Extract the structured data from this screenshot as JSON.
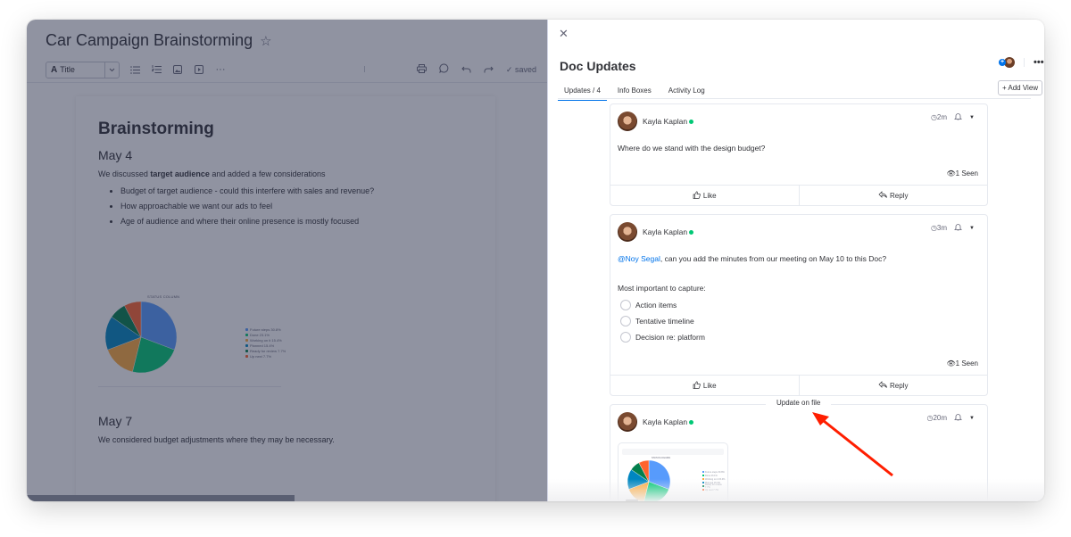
{
  "doc": {
    "title": "Car Campaign Brainstorming",
    "toolbar": {
      "style_select_icon": "A",
      "style_select_value": "Title",
      "icons": [
        "bulleted-list-icon",
        "numbered-list-icon",
        "image-icon",
        "video-icon",
        "more-icon"
      ],
      "right_icons": [
        "print-icon",
        "comment-icon",
        "undo-icon",
        "redo-icon"
      ],
      "saved_label": "saved"
    },
    "heading": "Brainstorming",
    "sections": [
      {
        "date": "May 4",
        "intro_prefix": "We discussed ",
        "intro_bold": "target audience",
        "intro_suffix": " and added a few considerations",
        "bullets": [
          "Budget of target audience - could this interfere with sales and revenue?",
          "How approachable we want our ads to feel",
          "Age of audience and where their online presence is mostly focused"
        ]
      },
      {
        "date": "May 7",
        "text": "We considered budget adjustments where they may be necessary."
      }
    ]
  },
  "chart_data": {
    "type": "pie",
    "title": "STATUS COLUMN",
    "categories": [
      "Future steps",
      "Done",
      "Working on it",
      "Planned",
      "Ready for review",
      "Up next"
    ],
    "values": [
      30.8,
      23.1,
      15.4,
      15.4,
      7.7,
      7.7
    ],
    "legend_labels": [
      "Future steps 30.8%",
      "Done 23.1%",
      "Working on it 15.4%",
      "Planned 15.4%",
      "Ready for review 7.7%",
      "Up next 7.7%"
    ],
    "colors": [
      "#579bfc",
      "#00c875",
      "#fdab3d",
      "#0086c0",
      "#037f4c",
      "#ff642e"
    ],
    "legend_position": "right"
  },
  "panel": {
    "close_icon": "close-icon",
    "title": "Doc Updates",
    "tabs": [
      {
        "label": "Updates / 4",
        "active": true
      },
      {
        "label": "Info Boxes",
        "active": false
      },
      {
        "label": "Activity Log",
        "active": false
      }
    ],
    "subscribe_plus": "+",
    "more_label": "•••",
    "add_view_label": "+ Add View",
    "updates": [
      {
        "author": "Kayla Kaplan",
        "time": "2m",
        "text": "Where do we stand with the design budget?",
        "seen": "1 Seen",
        "like_label": "Like",
        "reply_label": "Reply"
      },
      {
        "author": "Kayla Kaplan",
        "time": "3m",
        "mention": "@Noy Segal",
        "text": ", can you add the minutes from our meeting on May 10 to this Doc?",
        "subheading": "Most important to capture:",
        "checklist": [
          "Action items",
          "Tentative timeline",
          "Decision re: platform"
        ],
        "seen": "1 Seen",
        "like_label": "Like",
        "reply_label": "Reply"
      },
      {
        "label": "Update on file",
        "author": "Kayla Kaplan",
        "time": "20m",
        "file_thumbnail_title": "STATUS COLUMN"
      }
    ]
  },
  "annotation": {
    "arrow_color": "#ff1e00"
  }
}
